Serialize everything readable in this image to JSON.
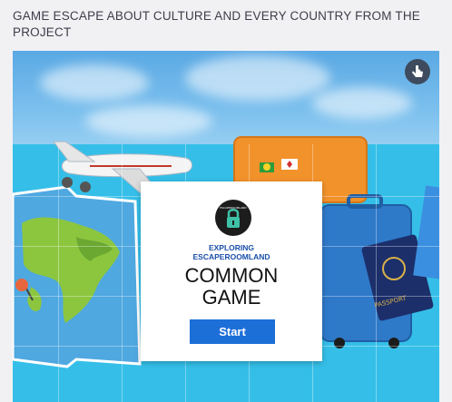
{
  "page": {
    "heading": "GAME ESCAPE ABOUT CULTURE AND EVERY COUNTRY FROM THE PROJECT"
  },
  "embed": {
    "fullscreen_icon": "hand-pointer-icon",
    "card": {
      "logo_icon": "padlock-icon",
      "logo_text": "ESCAPEROOMLAND",
      "subtitle_line1": "EXPLORING",
      "subtitle_line2": "ESCAPEROOMLAND",
      "title_line1": "COMMON",
      "title_line2": "GAME",
      "start_label": "Start"
    },
    "illustration": {
      "passport_label": "PASSPORT"
    }
  },
  "colors": {
    "background": "#f1f1f4",
    "sky": "#5aa9e4",
    "scene": "#35bfe8",
    "start_button": "#1d6fd8",
    "subtitle": "#1a4fa8",
    "suitcase_orange": "#f2922b",
    "suitcase_blue": "#2f79c9"
  }
}
